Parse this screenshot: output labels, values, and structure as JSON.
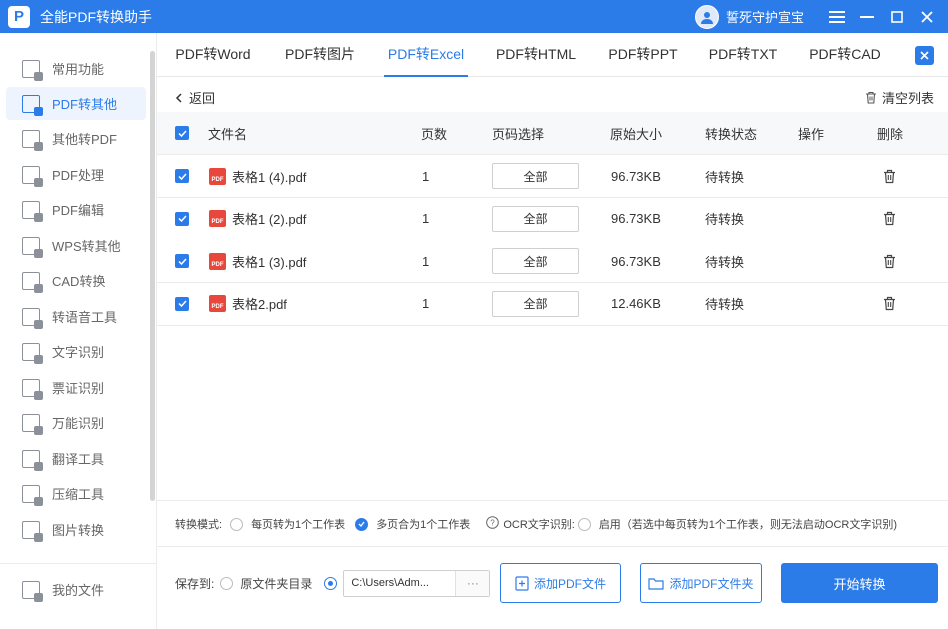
{
  "app": {
    "title": "全能PDF转换助手",
    "logo_letter": "P",
    "user_name": "誓死守护宣宝"
  },
  "sidebar": {
    "items": [
      {
        "label": "常用功能",
        "icon": "star-icon"
      },
      {
        "label": "PDF转其他",
        "icon": "pdf-convert-icon"
      },
      {
        "label": "其他转PDF",
        "icon": "to-pdf-icon"
      },
      {
        "label": "PDF处理",
        "icon": "pdf-process-icon"
      },
      {
        "label": "PDF编辑",
        "icon": "pdf-edit-icon"
      },
      {
        "label": "WPS转其他",
        "icon": "wps-icon"
      },
      {
        "label": "CAD转换",
        "icon": "cad-icon"
      },
      {
        "label": "转语音工具",
        "icon": "voice-icon"
      },
      {
        "label": "文字识别",
        "icon": "text-ocr-icon"
      },
      {
        "label": "票证识别",
        "icon": "ticket-ocr-icon"
      },
      {
        "label": "万能识别",
        "icon": "universal-ocr-icon"
      },
      {
        "label": "翻译工具",
        "icon": "translate-icon"
      },
      {
        "label": "压缩工具",
        "icon": "compress-icon"
      },
      {
        "label": "图片转换",
        "icon": "image-convert-icon"
      }
    ],
    "my_files": "我的文件",
    "active_index": 1
  },
  "tabs": [
    "PDF转Word",
    "PDF转图片",
    "PDF转Excel",
    "PDF转HTML",
    "PDF转PPT",
    "PDF转TXT",
    "PDF转CAD"
  ],
  "active_tab": 2,
  "toolbar": {
    "back_label": "返回",
    "clear_label": "清空列表"
  },
  "table": {
    "headers": {
      "filename": "文件名",
      "pages": "页数",
      "page_select": "页码选择",
      "size": "原始大小",
      "status": "转换状态",
      "action": "操作",
      "delete": "删除"
    },
    "rows": [
      {
        "filename": "表格1 (4).pdf",
        "pages": "1",
        "page_select": "全部",
        "size": "96.73KB",
        "status": "待转换"
      },
      {
        "filename": "表格1 (2).pdf",
        "pages": "1",
        "page_select": "全部",
        "size": "96.73KB",
        "status": "待转换"
      },
      {
        "filename": "表格1 (3).pdf",
        "pages": "1",
        "page_select": "全部",
        "size": "96.73KB",
        "status": "待转换"
      },
      {
        "filename": "表格2.pdf",
        "pages": "1",
        "page_select": "全部",
        "size": "12.46KB",
        "status": "待转换"
      }
    ],
    "pdf_badge": "PDF"
  },
  "options": {
    "mode_label": "转换模式:",
    "mode_one_per_page": "每页转为1个工作表",
    "mode_multi_to_one": "多页合为1个工作表",
    "ocr_label": "OCR文字识别:",
    "ocr_enable": "启用（若选中每页转为1个工作表，则无法启动OCR文字识别)",
    "save_label": "保存到:",
    "save_original": "原文件夹目录",
    "save_path": "C:\\Users\\Adm...",
    "path_more": "···"
  },
  "buttons": {
    "add_file": "添加PDF文件",
    "add_folder": "添加PDF文件夹",
    "start": "开始转换"
  },
  "colors": {
    "accent": "#2b7ce9",
    "pdf_red": "#e8473c"
  }
}
